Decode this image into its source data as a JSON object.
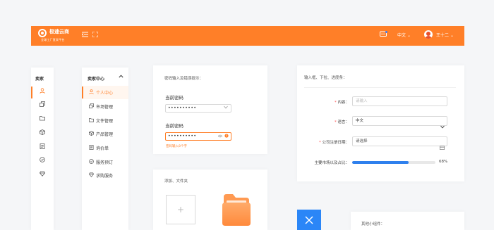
{
  "topbar": {
    "brand_title": "极速云商",
    "brand_sub": "全球工厂直采平台",
    "language": "中文",
    "language_caret": "⌄",
    "username": "王十二",
    "user_caret": "⌄"
  },
  "icon_rail": {
    "title": "卖家",
    "icons": [
      "user-icon",
      "cube-icon",
      "folder-icon",
      "box-icon",
      "document-icon",
      "check-circle-icon",
      "diamond-icon"
    ]
  },
  "seller_nav": {
    "header": "卖家中心",
    "items": [
      {
        "label": "个人中心",
        "icon": "user-icon"
      },
      {
        "label": "市场管理",
        "icon": "cube-icon"
      },
      {
        "label": "文件管理",
        "icon": "folder-icon"
      },
      {
        "label": "产品管理",
        "icon": "box-icon"
      },
      {
        "label": "询价单",
        "icon": "document-icon"
      },
      {
        "label": "服务预订",
        "icon": "check-circle-icon"
      },
      {
        "label": "求购服务",
        "icon": "diamond-icon"
      }
    ]
  },
  "password_card": {
    "section_label": "密码输入及错误提示：",
    "current_label": "当前密码",
    "current_value": "••••••••••",
    "new_label": "当前密码",
    "new_value": "••••••••••",
    "error_text": "密码输入8个字"
  },
  "upload_card": {
    "section_label": "添加、文件夹",
    "add_symbol": "+"
  },
  "form_card": {
    "section_label": "输入框、下拉、进度条：",
    "content_label": "内容：",
    "content_placeholder": "请输入",
    "language_label": "语言：",
    "language_value": "中文",
    "date_label": "公司注册日期：",
    "date_placeholder": "请选择",
    "progress_label": "主要市场以及占比：",
    "progress_value": 0.68,
    "progress_text": "68%"
  },
  "other_card": {
    "section_label": "其他小组件："
  },
  "colors": {
    "accent": "#ff7f28",
    "progress": "#2f80ed",
    "action_blue": "#2b86f7"
  }
}
